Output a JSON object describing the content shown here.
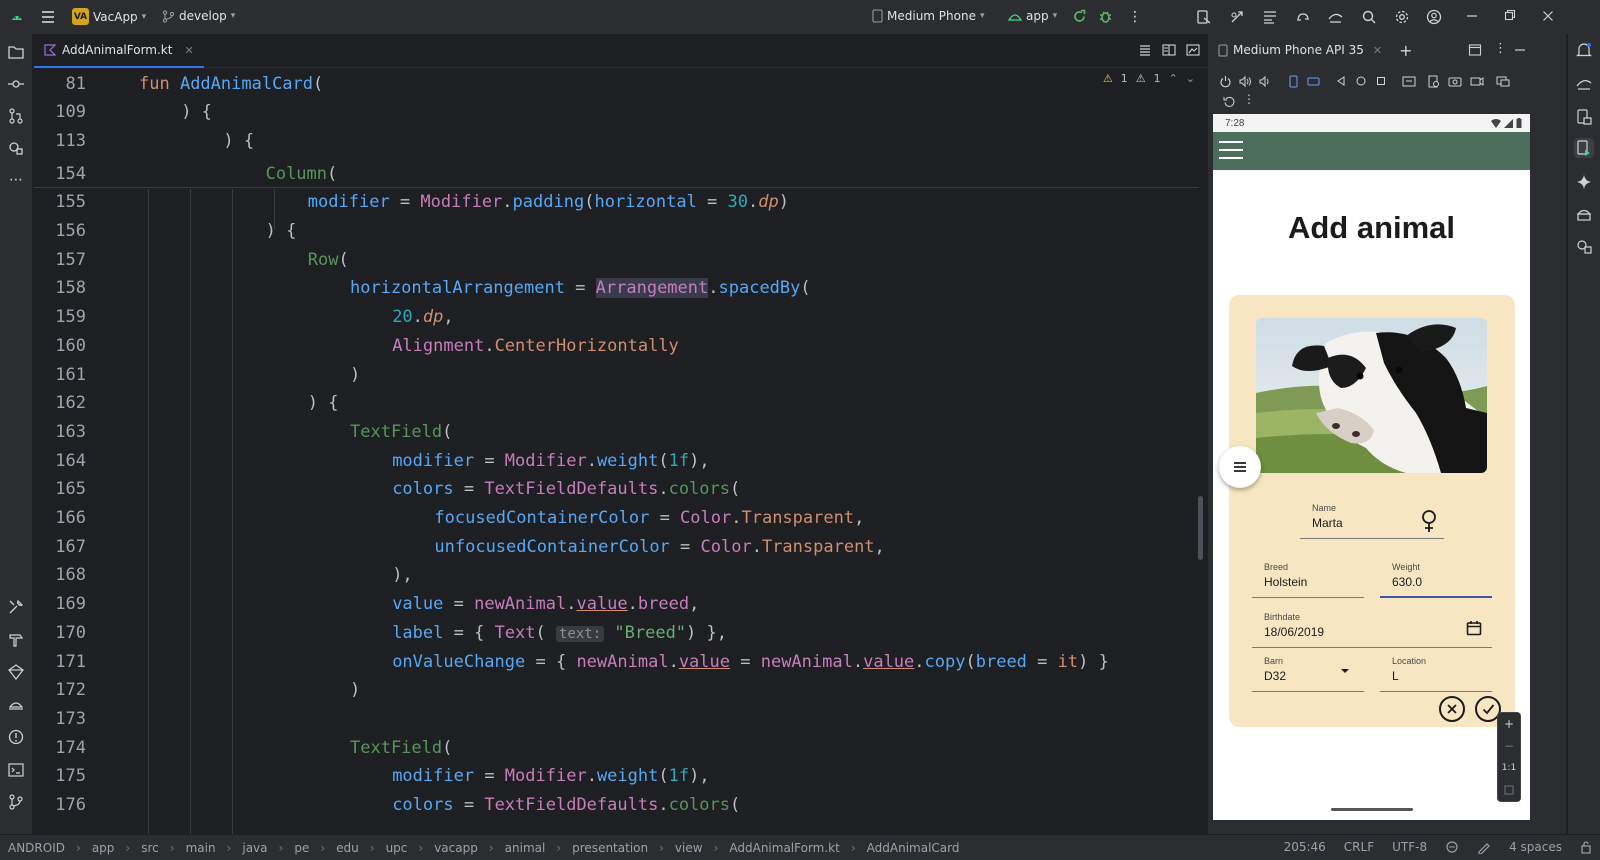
{
  "titlebar": {
    "project_badge": "VA",
    "project_name": "VacApp",
    "branch": "develop",
    "device_selector": "Medium Phone",
    "run_config": "app"
  },
  "editor": {
    "tab_label": "AddAnimalForm.kt",
    "inspection": {
      "warnings": "1",
      "weak_warnings": "1"
    },
    "lines": [
      {
        "n": "81",
        "segs": [
          [
            "kw",
            "fun "
          ],
          [
            "fn",
            "AddAnimalCard"
          ],
          [
            "plain",
            "("
          ]
        ],
        "indent": 4
      },
      {
        "n": "109",
        "segs": [
          [
            "plain",
            ") {"
          ]
        ],
        "indent": 5
      },
      {
        "n": "113",
        "segs": [
          [
            "plain",
            ") {"
          ]
        ],
        "indent": 6
      },
      {
        "n": "154",
        "segs": [
          [
            "cmpfn",
            "Column"
          ],
          [
            "plain",
            "("
          ]
        ],
        "indent": 7
      },
      {
        "n": "155",
        "segs": [
          [
            "param",
            "modifier"
          ],
          [
            "plain",
            " = "
          ],
          [
            "cl",
            "Modifier"
          ],
          [
            "plain",
            "."
          ],
          [
            "fn",
            "padding"
          ],
          [
            "plain",
            "("
          ],
          [
            "param",
            "horizontal"
          ],
          [
            "plain",
            " = "
          ],
          [
            "nm",
            "30"
          ],
          [
            "plain",
            "."
          ],
          [
            "ext",
            "dp"
          ],
          [
            "plain",
            ")"
          ]
        ],
        "indent": 8
      },
      {
        "n": "156",
        "segs": [
          [
            "plain",
            ") {"
          ]
        ],
        "indent": 7
      },
      {
        "n": "157",
        "segs": [
          [
            "cmpfn",
            "Row"
          ],
          [
            "plain",
            "("
          ]
        ],
        "indent": 8
      },
      {
        "n": "158",
        "segs": [
          [
            "param",
            "horizontalArrangement"
          ],
          [
            "plain",
            " = "
          ],
          [
            "hl",
            "Arrangement"
          ],
          [
            "plain",
            "."
          ],
          [
            "fn",
            "spacedBy"
          ],
          [
            "plain",
            "("
          ]
        ],
        "indent": 9
      },
      {
        "n": "159",
        "segs": [
          [
            "nm",
            "20"
          ],
          [
            "plain",
            "."
          ],
          [
            "ext",
            "dp"
          ],
          [
            "plain",
            ","
          ]
        ],
        "indent": 10
      },
      {
        "n": "160",
        "segs": [
          [
            "cl",
            "Alignment"
          ],
          [
            "plain",
            "."
          ],
          [
            "kw",
            "CenterHorizontally"
          ]
        ],
        "indent": 10
      },
      {
        "n": "161",
        "segs": [
          [
            "plain",
            ")"
          ]
        ],
        "indent": 9
      },
      {
        "n": "162",
        "segs": [
          [
            "plain",
            ") {"
          ]
        ],
        "indent": 8
      },
      {
        "n": "163",
        "segs": [
          [
            "cmpfn",
            "TextField"
          ],
          [
            "plain",
            "("
          ]
        ],
        "indent": 9
      },
      {
        "n": "164",
        "segs": [
          [
            "param",
            "modifier"
          ],
          [
            "plain",
            " = "
          ],
          [
            "cl",
            "Modifier"
          ],
          [
            "plain",
            "."
          ],
          [
            "fn",
            "weight"
          ],
          [
            "plain",
            "("
          ],
          [
            "nm",
            "1f"
          ],
          [
            "plain",
            "),"
          ]
        ],
        "indent": 10
      },
      {
        "n": "165",
        "segs": [
          [
            "param",
            "colors"
          ],
          [
            "plain",
            " = "
          ],
          [
            "cl",
            "TextFieldDefaults"
          ],
          [
            "plain",
            "."
          ],
          [
            "cmpfn",
            "colors"
          ],
          [
            "plain",
            "("
          ]
        ],
        "indent": 10
      },
      {
        "n": "166",
        "segs": [
          [
            "param",
            "focusedContainerColor"
          ],
          [
            "plain",
            " = "
          ],
          [
            "cl",
            "Color"
          ],
          [
            "plain",
            "."
          ],
          [
            "kw",
            "Transparent"
          ],
          [
            "plain",
            ","
          ]
        ],
        "indent": 11
      },
      {
        "n": "167",
        "segs": [
          [
            "param",
            "unfocusedContainerColor"
          ],
          [
            "plain",
            " = "
          ],
          [
            "cl",
            "Color"
          ],
          [
            "plain",
            "."
          ],
          [
            "kw",
            "Transparent"
          ],
          [
            "plain",
            ","
          ]
        ],
        "indent": 11
      },
      {
        "n": "168",
        "segs": [
          [
            "plain",
            "),"
          ]
        ],
        "indent": 10
      },
      {
        "n": "169",
        "segs": [
          [
            "param",
            "value"
          ],
          [
            "plain",
            " = "
          ],
          [
            "prop",
            "newAnimal"
          ],
          [
            "plain",
            "."
          ],
          [
            "ulp",
            "value"
          ],
          [
            "plain",
            "."
          ],
          [
            "prop",
            "breed"
          ],
          [
            "plain",
            ","
          ]
        ],
        "indent": 10
      },
      {
        "n": "170",
        "segs": [
          [
            "param",
            "label"
          ],
          [
            "plain",
            " = { "
          ],
          [
            "cl",
            "Text"
          ],
          [
            "plain",
            "( "
          ],
          [
            "hint",
            "text:"
          ],
          [
            "st",
            " \"Breed\""
          ],
          [
            "plain",
            ") },"
          ]
        ],
        "indent": 10
      },
      {
        "n": "171",
        "segs": [
          [
            "param",
            "onValueChange"
          ],
          [
            "plain",
            " = { "
          ],
          [
            "prop",
            "newAnimal"
          ],
          [
            "plain",
            "."
          ],
          [
            "ulp",
            "value"
          ],
          [
            "plain",
            " = "
          ],
          [
            "prop",
            "newAnimal"
          ],
          [
            "plain",
            "."
          ],
          [
            "ulp",
            "value"
          ],
          [
            "plain",
            "."
          ],
          [
            "fn",
            "copy"
          ],
          [
            "plain",
            "("
          ],
          [
            "param",
            "breed"
          ],
          [
            "plain",
            " = "
          ],
          [
            "kw",
            "it"
          ],
          [
            "plain",
            ") }"
          ]
        ],
        "indent": 10
      },
      {
        "n": "172",
        "segs": [
          [
            "plain",
            ")"
          ]
        ],
        "indent": 9
      },
      {
        "n": "173",
        "segs": [],
        "indent": 9
      },
      {
        "n": "174",
        "segs": [
          [
            "cmpfn",
            "TextField"
          ],
          [
            "plain",
            "("
          ]
        ],
        "indent": 9
      },
      {
        "n": "175",
        "segs": [
          [
            "param",
            "modifier"
          ],
          [
            "plain",
            " = "
          ],
          [
            "cl",
            "Modifier"
          ],
          [
            "plain",
            "."
          ],
          [
            "fn",
            "weight"
          ],
          [
            "plain",
            "("
          ],
          [
            "nm",
            "1f"
          ],
          [
            "plain",
            "),"
          ]
        ],
        "indent": 10
      },
      {
        "n": "176",
        "segs": [
          [
            "param",
            "colors"
          ],
          [
            "plain",
            " = "
          ],
          [
            "cl",
            "TextFieldDefaults"
          ],
          [
            "plain",
            "."
          ],
          [
            "cmpfn",
            "colors"
          ],
          [
            "plain",
            "("
          ]
        ],
        "indent": 10
      }
    ]
  },
  "device_panel": {
    "tab_label": "Medium Phone API 35",
    "phone": {
      "time": "7:28",
      "title": "Add animal",
      "fields": {
        "name": {
          "label": "Name",
          "value": "Marta"
        },
        "breed": {
          "label": "Breed",
          "value": "Holstein"
        },
        "weight": {
          "label": "Weight",
          "value": "630.0"
        },
        "birthdate": {
          "label": "Birthdate",
          "value": "18/06/2019"
        },
        "barn": {
          "label": "Barn",
          "value": "D32"
        },
        "location": {
          "label": "Location",
          "value": "L"
        }
      }
    },
    "zoom": {
      "plus": "+",
      "minus": "−",
      "ratio": "1:1"
    }
  },
  "statusbar": {
    "crumbs": [
      "ANDROID",
      "app",
      "src",
      "main",
      "java",
      "pe",
      "edu",
      "upc",
      "vacapp",
      "animal",
      "presentation",
      "view",
      "AddAnimalForm.kt",
      "AddAnimalCard"
    ],
    "position": "205:46",
    "line_sep": "CRLF",
    "encoding": "UTF-8",
    "indent": "4 spaces"
  },
  "colors": {
    "app_bar": "#4e6e5d",
    "card": "#f7e6c1",
    "accent": "#3574f0"
  }
}
